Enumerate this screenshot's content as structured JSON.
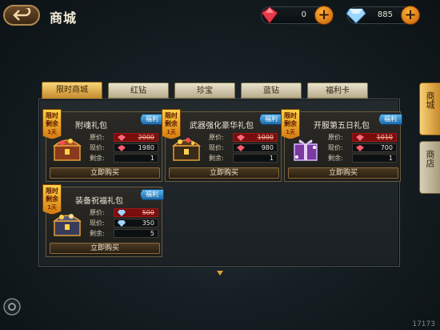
{
  "header": {
    "title": "商城",
    "currencies": [
      {
        "icon": "red-gem-icon",
        "amount": "0"
      },
      {
        "icon": "blue-diamond-icon",
        "amount": "885"
      }
    ]
  },
  "tabs": [
    "限时商城",
    "红钻",
    "珍宝",
    "蓝钻",
    "福利卡"
  ],
  "active_tab": "限时商城",
  "side_tabs": [
    "商城",
    "商店"
  ],
  "tag_text": {
    "line1": "限时",
    "line2": "剩余",
    "line3": "1天"
  },
  "badge_text": "福利",
  "labels": {
    "original": "原价:",
    "current": "现价:",
    "remaining": "剩余:",
    "buy": "立即购买"
  },
  "cards": [
    {
      "name": "附魂礼包",
      "original": "2000",
      "current": "1980",
      "remaining": "1",
      "gem": "red"
    },
    {
      "name": "武器强化豪华礼包",
      "original": "1000",
      "current": "980",
      "remaining": "1",
      "gem": "red"
    },
    {
      "name": "开服第五日礼包",
      "original": "1010",
      "current": "700",
      "remaining": "1",
      "gem": "red"
    },
    {
      "name": "装备祝福礼包",
      "original": "500",
      "current": "350",
      "remaining": "5",
      "gem": "blue"
    }
  ],
  "watermark": "17173"
}
